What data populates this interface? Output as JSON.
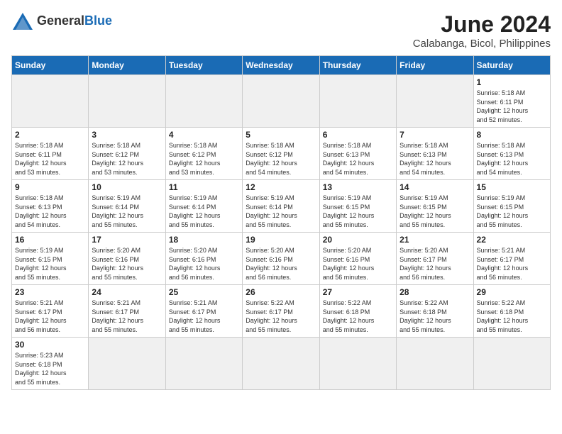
{
  "header": {
    "logo_general": "General",
    "logo_blue": "Blue",
    "title": "June 2024",
    "subtitle": "Calabanga, Bicol, Philippines"
  },
  "days_of_week": [
    "Sunday",
    "Monday",
    "Tuesday",
    "Wednesday",
    "Thursday",
    "Friday",
    "Saturday"
  ],
  "weeks": [
    [
      {
        "num": "",
        "info": ""
      },
      {
        "num": "",
        "info": ""
      },
      {
        "num": "",
        "info": ""
      },
      {
        "num": "",
        "info": ""
      },
      {
        "num": "",
        "info": ""
      },
      {
        "num": "",
        "info": ""
      },
      {
        "num": "1",
        "info": "Sunrise: 5:18 AM\nSunset: 6:11 PM\nDaylight: 12 hours\nand 52 minutes."
      }
    ],
    [
      {
        "num": "2",
        "info": "Sunrise: 5:18 AM\nSunset: 6:11 PM\nDaylight: 12 hours\nand 53 minutes."
      },
      {
        "num": "3",
        "info": "Sunrise: 5:18 AM\nSunset: 6:12 PM\nDaylight: 12 hours\nand 53 minutes."
      },
      {
        "num": "4",
        "info": "Sunrise: 5:18 AM\nSunset: 6:12 PM\nDaylight: 12 hours\nand 53 minutes."
      },
      {
        "num": "5",
        "info": "Sunrise: 5:18 AM\nSunset: 6:12 PM\nDaylight: 12 hours\nand 54 minutes."
      },
      {
        "num": "6",
        "info": "Sunrise: 5:18 AM\nSunset: 6:13 PM\nDaylight: 12 hours\nand 54 minutes."
      },
      {
        "num": "7",
        "info": "Sunrise: 5:18 AM\nSunset: 6:13 PM\nDaylight: 12 hours\nand 54 minutes."
      },
      {
        "num": "8",
        "info": "Sunrise: 5:18 AM\nSunset: 6:13 PM\nDaylight: 12 hours\nand 54 minutes."
      }
    ],
    [
      {
        "num": "9",
        "info": "Sunrise: 5:18 AM\nSunset: 6:13 PM\nDaylight: 12 hours\nand 54 minutes."
      },
      {
        "num": "10",
        "info": "Sunrise: 5:19 AM\nSunset: 6:14 PM\nDaylight: 12 hours\nand 55 minutes."
      },
      {
        "num": "11",
        "info": "Sunrise: 5:19 AM\nSunset: 6:14 PM\nDaylight: 12 hours\nand 55 minutes."
      },
      {
        "num": "12",
        "info": "Sunrise: 5:19 AM\nSunset: 6:14 PM\nDaylight: 12 hours\nand 55 minutes."
      },
      {
        "num": "13",
        "info": "Sunrise: 5:19 AM\nSunset: 6:15 PM\nDaylight: 12 hours\nand 55 minutes."
      },
      {
        "num": "14",
        "info": "Sunrise: 5:19 AM\nSunset: 6:15 PM\nDaylight: 12 hours\nand 55 minutes."
      },
      {
        "num": "15",
        "info": "Sunrise: 5:19 AM\nSunset: 6:15 PM\nDaylight: 12 hours\nand 55 minutes."
      }
    ],
    [
      {
        "num": "16",
        "info": "Sunrise: 5:19 AM\nSunset: 6:15 PM\nDaylight: 12 hours\nand 55 minutes."
      },
      {
        "num": "17",
        "info": "Sunrise: 5:20 AM\nSunset: 6:16 PM\nDaylight: 12 hours\nand 55 minutes."
      },
      {
        "num": "18",
        "info": "Sunrise: 5:20 AM\nSunset: 6:16 PM\nDaylight: 12 hours\nand 56 minutes."
      },
      {
        "num": "19",
        "info": "Sunrise: 5:20 AM\nSunset: 6:16 PM\nDaylight: 12 hours\nand 56 minutes."
      },
      {
        "num": "20",
        "info": "Sunrise: 5:20 AM\nSunset: 6:16 PM\nDaylight: 12 hours\nand 56 minutes."
      },
      {
        "num": "21",
        "info": "Sunrise: 5:20 AM\nSunset: 6:17 PM\nDaylight: 12 hours\nand 56 minutes."
      },
      {
        "num": "22",
        "info": "Sunrise: 5:21 AM\nSunset: 6:17 PM\nDaylight: 12 hours\nand 56 minutes."
      }
    ],
    [
      {
        "num": "23",
        "info": "Sunrise: 5:21 AM\nSunset: 6:17 PM\nDaylight: 12 hours\nand 56 minutes."
      },
      {
        "num": "24",
        "info": "Sunrise: 5:21 AM\nSunset: 6:17 PM\nDaylight: 12 hours\nand 55 minutes."
      },
      {
        "num": "25",
        "info": "Sunrise: 5:21 AM\nSunset: 6:17 PM\nDaylight: 12 hours\nand 55 minutes."
      },
      {
        "num": "26",
        "info": "Sunrise: 5:22 AM\nSunset: 6:17 PM\nDaylight: 12 hours\nand 55 minutes."
      },
      {
        "num": "27",
        "info": "Sunrise: 5:22 AM\nSunset: 6:18 PM\nDaylight: 12 hours\nand 55 minutes."
      },
      {
        "num": "28",
        "info": "Sunrise: 5:22 AM\nSunset: 6:18 PM\nDaylight: 12 hours\nand 55 minutes."
      },
      {
        "num": "29",
        "info": "Sunrise: 5:22 AM\nSunset: 6:18 PM\nDaylight: 12 hours\nand 55 minutes."
      }
    ],
    [
      {
        "num": "30",
        "info": "Sunrise: 5:23 AM\nSunset: 6:18 PM\nDaylight: 12 hours\nand 55 minutes."
      },
      {
        "num": "",
        "info": ""
      },
      {
        "num": "",
        "info": ""
      },
      {
        "num": "",
        "info": ""
      },
      {
        "num": "",
        "info": ""
      },
      {
        "num": "",
        "info": ""
      },
      {
        "num": "",
        "info": ""
      }
    ]
  ]
}
